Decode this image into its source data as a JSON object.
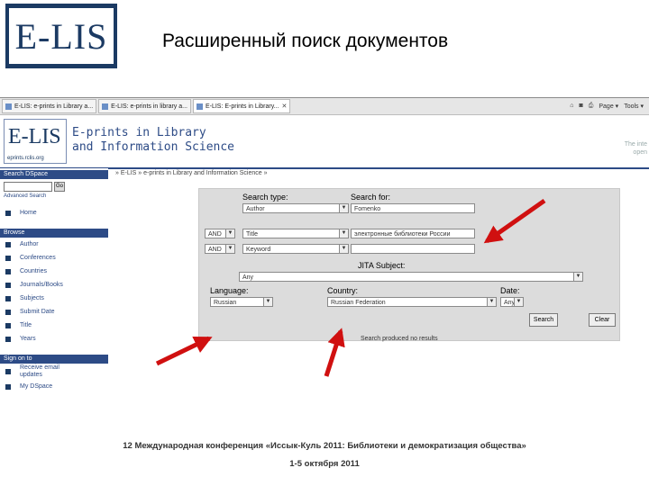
{
  "slide": {
    "logo_text": "E-LIS",
    "title": "Расширенный поиск документов",
    "footer_line1": "12 Международная конференция «Иссык-Куль 2011: Библиотеки и демократизация общества»",
    "footer_line2": "1-5 октября 2011"
  },
  "browser": {
    "tabs": [
      "E-LIS: e-prints in Library a...",
      "E-LIS: e-prints in library a...",
      "E-LIS: E-prints in Library..."
    ],
    "tools": [
      "Page ▾",
      "Tools ▾"
    ],
    "corner_text_1": "The inte",
    "corner_text_2": "open"
  },
  "site": {
    "logo": "E-LIS",
    "logo_sub": "eprints.rclis.org",
    "name_line1": "E-prints in Library",
    "name_line2": "and Information Science"
  },
  "sidebar": {
    "search_head": "Search DSpace",
    "search_btn": "Go",
    "advanced": "Advanced Search",
    "home": "Home",
    "browse_head": "Browse",
    "browse_items": [
      "Author",
      "Conferences",
      "Countries",
      "Journals/Books",
      "Subjects",
      "Submit Date",
      "Title",
      "Years"
    ],
    "signon_head": "Sign on to",
    "signon_items": [
      "Receive email updates",
      "My DSpace"
    ]
  },
  "main": {
    "breadcrumb": "» E-LIS » e-prints in Library and Information Science »",
    "search_type_label": "Search type:",
    "search_for_label": "Search for:",
    "row1_type": "Author",
    "row1_value": "Fomenko",
    "row2_op": "AND",
    "row2_type": "Title",
    "row2_value": "электронные библиотеки России",
    "row3_op": "AND",
    "row3_type": "Keyword",
    "row3_value": "",
    "jita_label": "JITA Subject:",
    "jita_value": "Any",
    "language_label": "Language:",
    "language_value": "Russian",
    "country_label": "Country:",
    "country_value": "Russian Federation",
    "date_label": "Date:",
    "date_value": "Any",
    "search_btn": "Search",
    "clear_btn": "Clear",
    "hint": "Search produced no results"
  }
}
